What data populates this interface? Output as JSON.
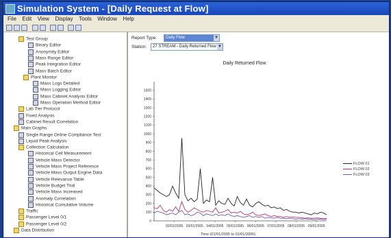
{
  "window": {
    "title": "Simulation System - [Daily Request at Flow]"
  },
  "menu": [
    "File",
    "Edit",
    "View",
    "Display",
    "Tools",
    "Window",
    "Help"
  ],
  "toolbar_icons": [
    "save-icon",
    "open-icon",
    "print-icon",
    "undo-icon",
    "redo-icon",
    "copy-icon",
    "paste-icon",
    "chart-icon",
    "zoom-icon"
  ],
  "tree": {
    "items": [
      {
        "label": "Test Group",
        "icon": "folder-icon",
        "depth": 2
      },
      {
        "label": "Binary Editor",
        "icon": "doc-icon",
        "depth": 4
      },
      {
        "label": "Anonymity Editor",
        "icon": "doc-icon",
        "depth": 4
      },
      {
        "label": "Mass Range Editor",
        "icon": "doc-icon",
        "depth": 4
      },
      {
        "label": "Peak Integration Editor",
        "icon": "doc-icon",
        "depth": 4
      },
      {
        "label": "Mass Batch Editor",
        "icon": "doc-icon",
        "depth": 4
      },
      {
        "label": "Plant Monitor",
        "icon": "folder-icon",
        "depth": 3
      },
      {
        "label": "Mass Logs Detailed",
        "icon": "doc-icon",
        "depth": 5
      },
      {
        "label": "Mass Logging Editor",
        "icon": "doc-icon",
        "depth": 5
      },
      {
        "label": "Mass Cabinet Analysis Editor",
        "icon": "doc-icon",
        "depth": 5
      },
      {
        "label": "Mass Operation Method Editor",
        "icon": "doc-icon",
        "depth": 5
      },
      {
        "label": "Lab Tier Protocol",
        "icon": "folder-icon",
        "depth": 2
      },
      {
        "label": "Fixed Analysis",
        "icon": "doc-icon",
        "depth": 2
      },
      {
        "label": "Cabinet Result Correlation",
        "icon": "doc-icon",
        "depth": 2
      },
      {
        "label": "Main Graphs",
        "icon": "folder-icon",
        "depth": 1
      },
      {
        "label": "Single Range Online Compliance Test",
        "icon": "doc-icon",
        "depth": 2
      },
      {
        "label": "Liquid Peak Analysis",
        "icon": "doc-icon",
        "depth": 2
      },
      {
        "label": "Collection Calculation",
        "icon": "folder-icon",
        "depth": 2
      },
      {
        "label": "Historical Cell Measurement",
        "icon": "doc-icon",
        "depth": 4
      },
      {
        "label": "Vehicle Mass Detector",
        "icon": "doc-icon",
        "depth": 4
      },
      {
        "label": "Vehicle Mass Project Reference",
        "icon": "doc-icon",
        "depth": 4
      },
      {
        "label": "Vehicle Mass Output Engine Data",
        "icon": "doc-icon",
        "depth": 4
      },
      {
        "label": "Vehicle Relevance Table",
        "icon": "doc-icon",
        "depth": 4
      },
      {
        "label": "Vehicle Budget Trial",
        "icon": "doc-icon",
        "depth": 4
      },
      {
        "label": "Vehicle Mass Increased",
        "icon": "doc-icon",
        "depth": 4
      },
      {
        "label": "Anomaly Correlation",
        "icon": "doc-icon",
        "depth": 4
      },
      {
        "label": "Historical Cumulative Volume",
        "icon": "doc-icon",
        "depth": 4
      },
      {
        "label": "Traffic",
        "icon": "folder-icon",
        "depth": 2
      },
      {
        "label": "Passenger Level 0/1",
        "icon": "folder-icon",
        "depth": 2
      },
      {
        "label": "Passenger Level 0/2",
        "icon": "folder-icon",
        "depth": 2
      },
      {
        "label": "Data Distribution",
        "icon": "folder-icon",
        "depth": 1
      }
    ]
  },
  "controls": {
    "report_type_label": "Report Type:",
    "report_type_value": "Daily Flow",
    "station_label": "Station:",
    "station_value": "27 STREAM - Daily Returned Flow"
  },
  "chart_data": {
    "type": "line",
    "title": "Daily Returned Flow",
    "xlabel": "Time (01/01/2005 to 01/01/2006)",
    "ylabel": "",
    "ylim": [
      0,
      1600
    ],
    "yticks": [
      0,
      100,
      200,
      300,
      400,
      500,
      600,
      700,
      800,
      900,
      1000,
      1100,
      1200,
      1300,
      1400,
      1500
    ],
    "xticks": [
      "02/01/2005",
      "03/01/2005",
      "04/01/2005",
      "05/01/2005",
      "06/01/2005",
      "07/01/2005",
      "08/01/2005",
      "09/01/2005"
    ],
    "series": [
      {
        "name": "FLOW 01",
        "color": "#222222",
        "values": [
          380,
          350,
          320,
          300,
          280,
          300,
          400,
          320,
          260,
          950,
          300,
          230,
          260,
          220,
          250,
          600,
          200,
          240,
          220,
          500,
          180,
          230,
          200,
          190,
          260,
          200,
          170,
          280,
          210,
          180,
          250,
          180,
          160,
          200,
          220,
          190,
          170,
          180,
          150,
          160,
          140,
          150,
          120,
          130,
          110,
          100,
          100,
          90,
          100,
          90,
          80,
          70,
          90,
          80,
          100,
          90,
          70
        ]
      },
      {
        "name": "FLOW 02",
        "color": "#b23a6b",
        "values": [
          150,
          140,
          180,
          120,
          100,
          130,
          110,
          160,
          110,
          220,
          130,
          100,
          120,
          150,
          130,
          110,
          100,
          120,
          110,
          100,
          150,
          90,
          100,
          110,
          130,
          90,
          100,
          90,
          110,
          80,
          70,
          80,
          100,
          70,
          60,
          70,
          80,
          60,
          50,
          60,
          50,
          50,
          40,
          50,
          40,
          45,
          40,
          40,
          35,
          30,
          35,
          30,
          30,
          35,
          30,
          25,
          30
        ]
      },
      {
        "name": "FLOW 03",
        "color": "#6a5ea8",
        "values": [
          90,
          110,
          100,
          90,
          70,
          80,
          90,
          70,
          100,
          120,
          70,
          80,
          60,
          70,
          100,
          90,
          60,
          80,
          70,
          60,
          80,
          60,
          70,
          60,
          80,
          60,
          50,
          60,
          50,
          40,
          50,
          60,
          40,
          50,
          40,
          50,
          30,
          40,
          35,
          30,
          40,
          30,
          30,
          25,
          30,
          25,
          20,
          25,
          20,
          25,
          20,
          20,
          15,
          20,
          20,
          15,
          20
        ]
      }
    ],
    "grid": false,
    "legend_position": "right"
  }
}
